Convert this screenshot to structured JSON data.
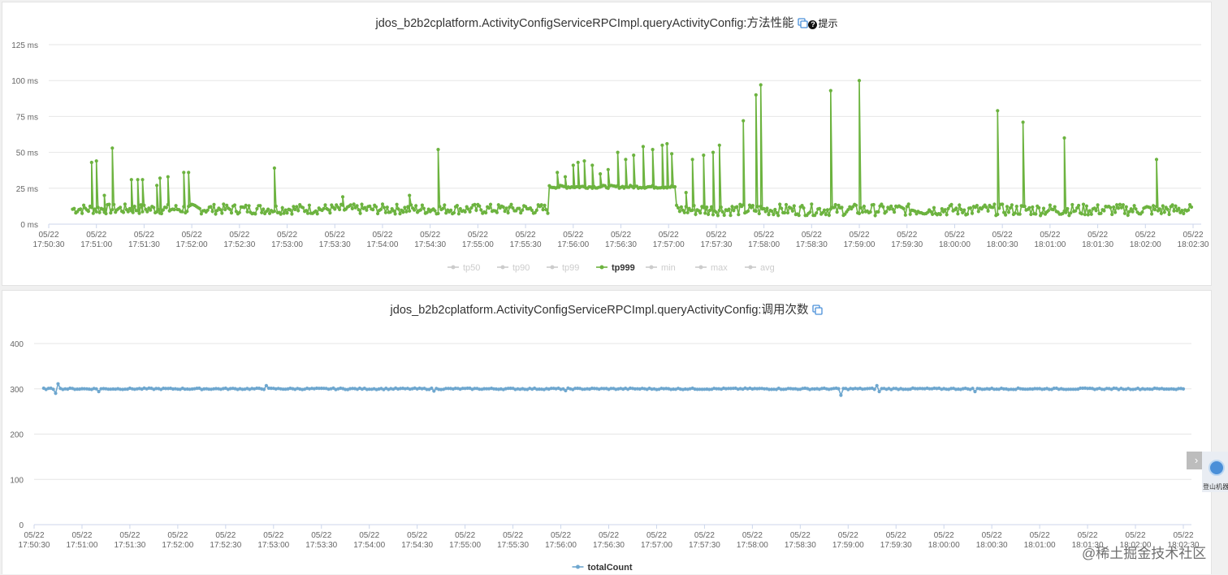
{
  "panel1": {
    "title": "jdos_b2b2cplatform.ActivityConfigServiceRPCImpl.queryActivityConfig:方法性能",
    "hint_label": "提示",
    "copy_icon": "copy-icon",
    "hint_icon": "question-circle-icon"
  },
  "panel2": {
    "title": "jdos_b2b2cplatform.ActivityConfigServiceRPCImpl.queryActivityConfig:调用次数",
    "copy_icon": "copy-icon"
  },
  "chart_data": [
    {
      "type": "line",
      "ylim": [
        0,
        125
      ],
      "yticks": [
        "0 ms",
        "25 ms",
        "50 ms",
        "75 ms",
        "100 ms",
        "125 ms"
      ],
      "yticks_values": [
        0,
        25,
        50,
        75,
        100,
        125
      ],
      "x_categories_date": [
        "05/22",
        "05/22",
        "05/22",
        "05/22",
        "05/22",
        "05/22",
        "05/22",
        "05/22",
        "05/22",
        "05/22",
        "05/22",
        "05/22",
        "05/22",
        "05/22",
        "05/22",
        "05/22",
        "05/22",
        "05/22",
        "05/22",
        "05/22",
        "05/22",
        "05/22",
        "05/22",
        "05/22",
        "05/22",
        "05/22",
        "05/22"
      ],
      "x_categories_time": [
        "17:50:30",
        "17:51:00",
        "17:51:30",
        "17:52:00",
        "17:52:30",
        "17:53:00",
        "17:53:30",
        "17:54:00",
        "17:54:30",
        "17:55:00",
        "17:55:30",
        "17:56:00",
        "17:56:30",
        "17:57:00",
        "17:57:30",
        "17:58:00",
        "17:58:30",
        "17:59:00",
        "17:59:30",
        "18:00:00",
        "18:00:30",
        "18:01:00",
        "18:01:30",
        "18:02:00",
        "18:02:30"
      ],
      "grid": true,
      "legend_position": "bottom-center",
      "legend": [
        {
          "name": "tp50",
          "active": false
        },
        {
          "name": "tp90",
          "active": false
        },
        {
          "name": "tp99",
          "active": false
        },
        {
          "name": "tp999",
          "active": true
        },
        {
          "name": "min",
          "active": false
        },
        {
          "name": "max",
          "active": false
        },
        {
          "name": "avg",
          "active": false
        }
      ],
      "series": [
        {
          "name": "tp999",
          "color": "#6cb33f",
          "x_range": [
            "17:50:45",
            "18:02:30"
          ],
          "segments": [
            {
              "from": "17:50:45",
              "to": "17:55:45",
              "baseline": [
                7,
                14
              ]
            },
            {
              "from": "17:55:45",
              "to": "17:57:05",
              "baseline": [
                25,
                27
              ]
            },
            {
              "from": "17:57:05",
              "to": "18:02:30",
              "baseline": [
                6,
                14
              ]
            }
          ],
          "spikes": [
            {
              "t": "17:50:57",
              "v": 43
            },
            {
              "t": "17:51:00",
              "v": 44
            },
            {
              "t": "17:51:10",
              "v": 53
            },
            {
              "t": "17:51:05",
              "v": 20
            },
            {
              "t": "17:51:22",
              "v": 31
            },
            {
              "t": "17:51:26",
              "v": 31
            },
            {
              "t": "17:51:29",
              "v": 31
            },
            {
              "t": "17:51:38",
              "v": 27
            },
            {
              "t": "17:51:40",
              "v": 32
            },
            {
              "t": "17:51:45",
              "v": 33
            },
            {
              "t": "17:51:55",
              "v": 36
            },
            {
              "t": "17:51:58",
              "v": 36
            },
            {
              "t": "17:52:52",
              "v": 39
            },
            {
              "t": "17:53:35",
              "v": 19
            },
            {
              "t": "17:54:17",
              "v": 20
            },
            {
              "t": "17:54:35",
              "v": 52
            },
            {
              "t": "17:55:50",
              "v": 36
            },
            {
              "t": "17:55:55",
              "v": 33
            },
            {
              "t": "17:56:00",
              "v": 41
            },
            {
              "t": "17:56:03",
              "v": 43
            },
            {
              "t": "17:56:07",
              "v": 44
            },
            {
              "t": "17:56:12",
              "v": 41
            },
            {
              "t": "17:56:17",
              "v": 35
            },
            {
              "t": "17:56:22",
              "v": 38
            },
            {
              "t": "17:56:28",
              "v": 50
            },
            {
              "t": "17:56:33",
              "v": 45
            },
            {
              "t": "17:56:38",
              "v": 48
            },
            {
              "t": "17:56:44",
              "v": 54
            },
            {
              "t": "17:56:50",
              "v": 52
            },
            {
              "t": "17:56:56",
              "v": 55
            },
            {
              "t": "17:56:59",
              "v": 56
            },
            {
              "t": "17:57:02",
              "v": 49
            },
            {
              "t": "17:57:11",
              "v": 22
            },
            {
              "t": "17:57:15",
              "v": 45
            },
            {
              "t": "17:57:22",
              "v": 48
            },
            {
              "t": "17:57:28",
              "v": 50
            },
            {
              "t": "17:57:32",
              "v": 55
            },
            {
              "t": "17:57:47",
              "v": 72
            },
            {
              "t": "17:57:55",
              "v": 90
            },
            {
              "t": "17:57:58",
              "v": 97
            },
            {
              "t": "17:58:42",
              "v": 93
            },
            {
              "t": "17:59:00",
              "v": 100
            },
            {
              "t": "18:00:27",
              "v": 79
            },
            {
              "t": "18:00:43",
              "v": 71
            },
            {
              "t": "18:01:09",
              "v": 60
            },
            {
              "t": "18:02:07",
              "v": 45
            }
          ]
        }
      ]
    },
    {
      "type": "line",
      "ylim": [
        0,
        400
      ],
      "yticks": [
        "0",
        "100",
        "200",
        "300",
        "400"
      ],
      "yticks_values": [
        0,
        100,
        200,
        300,
        400
      ],
      "x_categories_date": [
        "05/22",
        "05/22",
        "05/22",
        "05/22",
        "05/22",
        "05/22",
        "05/22",
        "05/22",
        "05/22",
        "05/22",
        "05/22",
        "05/22",
        "05/22",
        "05/22",
        "05/22",
        "05/22",
        "05/22",
        "05/22",
        "05/22",
        "05/22",
        "05/22",
        "05/22",
        "05/22",
        "05/22",
        "05/22"
      ],
      "x_categories_time": [
        "17:50:30",
        "17:51:00",
        "17:51:30",
        "17:52:00",
        "17:52:30",
        "17:53:00",
        "17:53:30",
        "17:54:00",
        "17:54:30",
        "17:55:00",
        "17:55:30",
        "17:56:00",
        "17:56:30",
        "17:57:00",
        "17:57:30",
        "17:58:00",
        "17:58:30",
        "17:59:00",
        "17:59:30",
        "18:00:00",
        "18:00:30",
        "18:01:00",
        "18:01:30",
        "18:02:00",
        "18:02:30"
      ],
      "grid": true,
      "legend_position": "bottom-center",
      "legend": [
        {
          "name": "totalCount",
          "active": true
        }
      ],
      "series": [
        {
          "name": "totalCount",
          "color": "#6ea7cf",
          "x_range": [
            "17:50:36",
            "18:02:30"
          ],
          "typical": 300,
          "outliers": [
            {
              "t": "17:50:43",
              "v": 290
            },
            {
              "t": "17:50:45",
              "v": 311
            },
            {
              "t": "17:51:10",
              "v": 294
            },
            {
              "t": "17:52:55",
              "v": 307
            },
            {
              "t": "17:54:40",
              "v": 295
            },
            {
              "t": "17:56:03",
              "v": 296
            },
            {
              "t": "17:58:56",
              "v": 286
            },
            {
              "t": "17:59:18",
              "v": 307
            },
            {
              "t": "17:59:20",
              "v": 294
            },
            {
              "t": "18:00:20",
              "v": 294
            }
          ]
        }
      ]
    }
  ],
  "side_widget": {
    "arrow": "›",
    "label": "登山机器"
  },
  "watermark": "@稀土掘金技术社区"
}
